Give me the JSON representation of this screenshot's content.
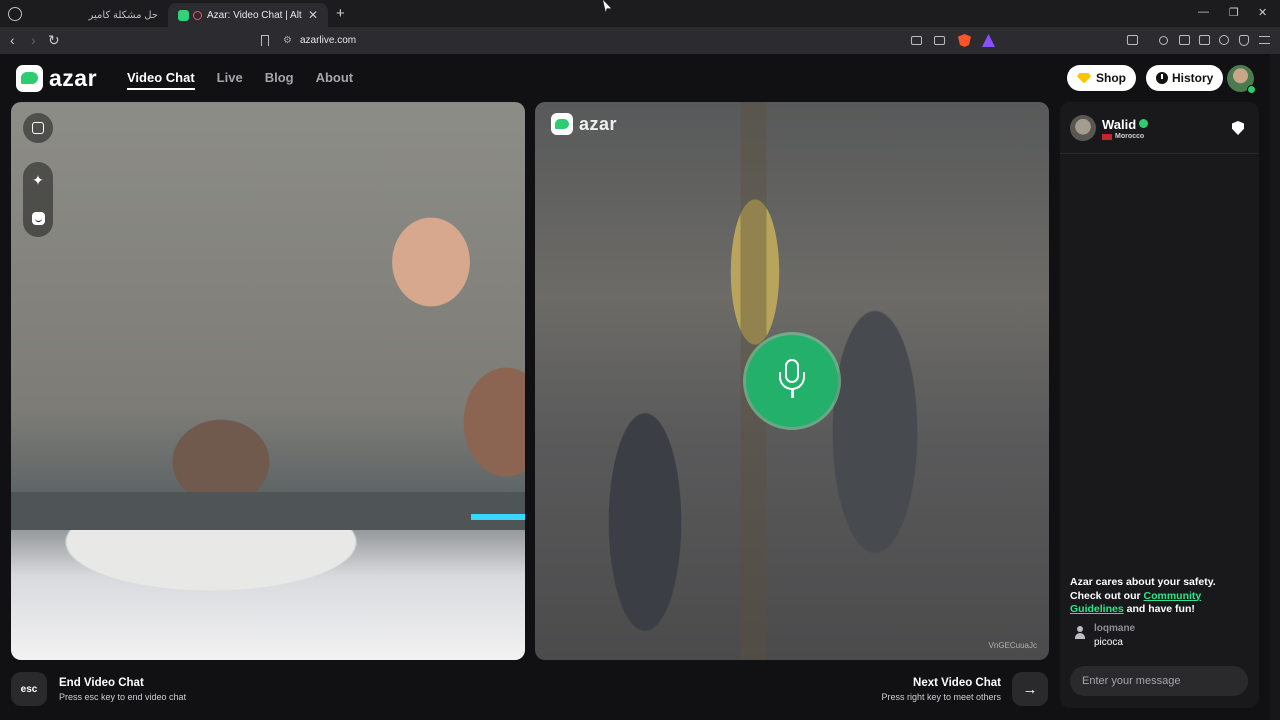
{
  "browser": {
    "tabs": [
      {
        "title": "حل مشكلة كاميرا Azar",
        "active": false
      },
      {
        "title": "Azar: Video Chat | Alternative",
        "active": true
      }
    ],
    "new_tab_label": "+",
    "tab_close_label": "✕",
    "window_controls": {
      "minimize": "—",
      "restore": "❐",
      "close": "✕"
    },
    "nav": {
      "back": "‹",
      "forward": "›",
      "reload": "↻"
    },
    "url_tune_icon": "⚙",
    "url": "azarlive.com"
  },
  "header": {
    "logo_text": "azar",
    "menu": [
      "Video Chat",
      "Live",
      "Blog",
      "About"
    ],
    "active_menu": "Video Chat",
    "shop_label": "Shop",
    "history_label": "History"
  },
  "left_video": {
    "tools": {
      "expand": "⤢",
      "effects": "✦"
    }
  },
  "right_video": {
    "watermark": "azar",
    "mic_state": "on",
    "video_id": "VnGECuuaJc"
  },
  "chat": {
    "peer_name": "Walid",
    "peer_country": "Morocco",
    "safety_text_1": "Azar cares about your safety. Check out our ",
    "safety_link": "Community Guidelines",
    "safety_text_2": " and have fun!",
    "messages": [
      {
        "user": "loqmane",
        "text": "picoca"
      }
    ],
    "input_placeholder": "Enter your message"
  },
  "controls": {
    "esc_key": "esc",
    "end_title": "End Video Chat",
    "end_hint": "Press esc key to end video chat",
    "next_title": "Next Video Chat",
    "next_hint": "Press right key to meet others",
    "next_icon": "→"
  },
  "colors": {
    "accent_green": "#2ecc71",
    "link_green": "#2ee68a",
    "background": "#111113",
    "panel": "#19191b"
  }
}
